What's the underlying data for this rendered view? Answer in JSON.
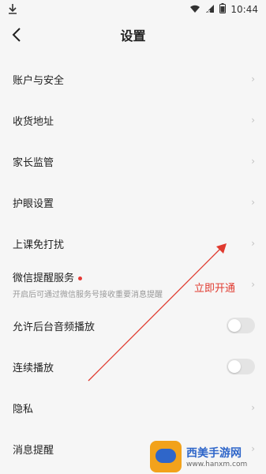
{
  "status_bar": {
    "time": "10:44"
  },
  "header": {
    "title": "设置"
  },
  "settings": {
    "items": [
      {
        "label": "账户与安全"
      },
      {
        "label": "收货地址"
      },
      {
        "label": "家长监管"
      },
      {
        "label": "护眼设置"
      },
      {
        "label": "上课免打扰"
      },
      {
        "label": "微信提醒服务",
        "subtitle": "开启后可通过微信服务号接收重要消息提醒"
      },
      {
        "label": "允许后台音频播放",
        "toggle": false
      },
      {
        "label": "连续播放",
        "toggle": false
      },
      {
        "label": "隐私"
      },
      {
        "label": "消息提醒"
      }
    ]
  },
  "annotation": {
    "text": "立即开通"
  },
  "watermark": {
    "main": "西美手游网",
    "sub": "www.hanxm.com"
  },
  "colors": {
    "annotation_red": "#e03a2f",
    "background": "#f6f6f6"
  }
}
